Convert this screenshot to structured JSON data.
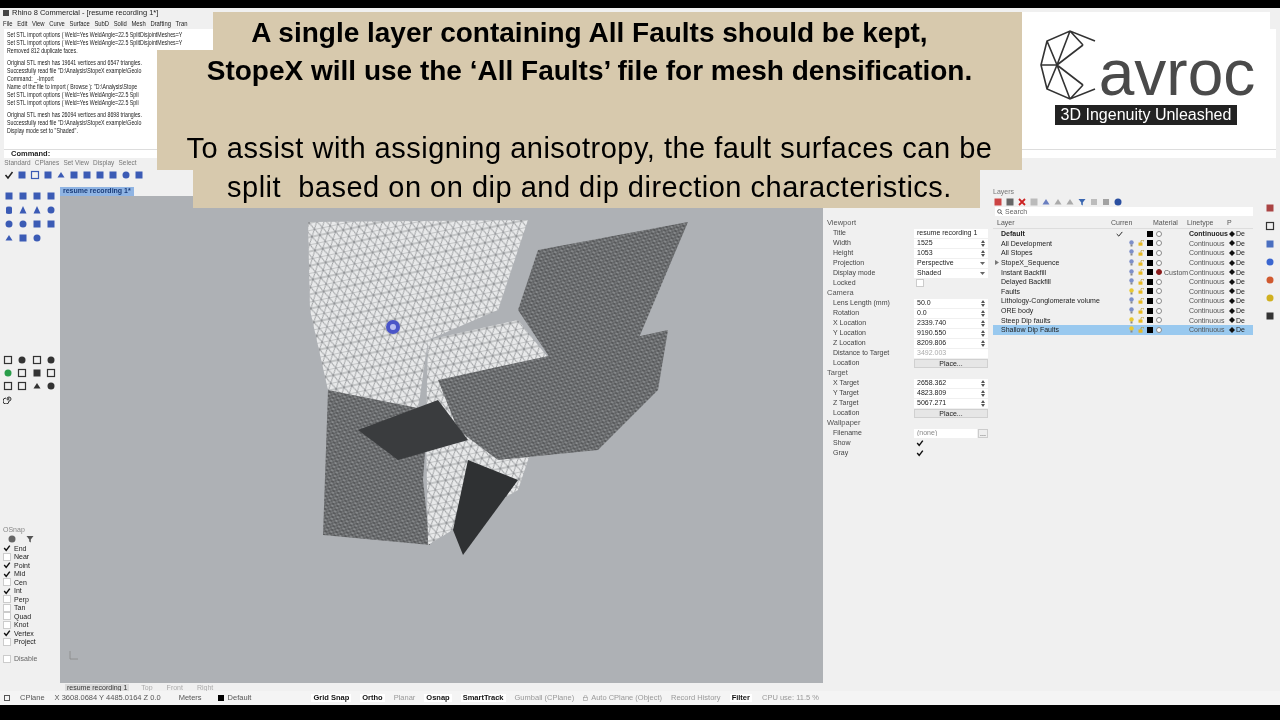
{
  "overlay": {
    "heading": [
      "A single layer containing All Faults should be kept,",
      "StopeX will use the ‘All Faults’ file for mesh densification."
    ],
    "body": [
      "To assist with assigning anisotropy, the fault surfaces can be",
      "split  based on on dip and dip direction characteristics."
    ]
  },
  "logo": {
    "wordmark": "avroc",
    "tagline": "3D Ingenuity Unleashed"
  },
  "window": {
    "title": "Rhino 8 Commercial - [resume recording 1*]"
  },
  "menu": [
    "File",
    "Edit",
    "View",
    "Curve",
    "Surface",
    "SubD",
    "Solid",
    "Mesh",
    "Drafting",
    "Tran"
  ],
  "command_history": [
    [
      "Set STL import options ( Weld=Yes WeldAngle=22.5 SplitDisjointMeshes=Y",
      "Set STL import options ( Weld=Yes WeldAngle=22.5 SplitDisjointMeshes=Y",
      "Removed 812 duplicate faces."
    ],
    [
      "Original STL mesh has 19641 vertices and 6547 triangles.",
      "Successfully read file \"D:\\Analysis\\StopeX example\\Geolo",
      "Command: _-Import",
      "Name of the file to import ( Browse ): \"D:\\Analysis\\Stope",
      "Set STL import options ( Weld=Yes WeldAngle=22.5 Spli",
      "Set STL import options ( Weld=Yes WeldAngle=22.5 Spli"
    ],
    [
      "Original STL mesh has 26094 vertices and 8698 triangles.",
      "Successfully read file \"D:\\Analysis\\StopeX example\\Geolo",
      "Display mode set to \"Shaded\"."
    ]
  ],
  "command_prompt": "Command:",
  "toolbar_tabs": [
    "Standard",
    "CPlanes",
    "Set View",
    "Display",
    "Select"
  ],
  "viewport": {
    "tab": "resume recording 1*",
    "bottom_tabs": [
      {
        "label": "resume recording 1",
        "selected": true
      },
      {
        "label": "Top",
        "selected": false
      },
      {
        "label": "Front",
        "selected": false
      },
      {
        "label": "Right",
        "selected": false
      }
    ]
  },
  "osnap": {
    "title": "OSnap",
    "items": [
      {
        "label": "End",
        "checked": true
      },
      {
        "label": "Near",
        "checked": false
      },
      {
        "label": "Point",
        "checked": true
      },
      {
        "label": "Mid",
        "checked": true
      },
      {
        "label": "Cen",
        "checked": false
      },
      {
        "label": "Int",
        "checked": true
      },
      {
        "label": "Perp",
        "checked": false
      },
      {
        "label": "Tan",
        "checked": false
      },
      {
        "label": "Quad",
        "checked": false
      },
      {
        "label": "Knot",
        "checked": false
      },
      {
        "label": "Vertex",
        "checked": true
      },
      {
        "label": "Project",
        "checked": false
      }
    ],
    "disable": {
      "label": "Disable",
      "checked": false
    }
  },
  "properties": {
    "sections": [
      {
        "title": "Viewport",
        "rows": [
          {
            "kind": "text",
            "label": "Title",
            "value": "resume recording 1"
          },
          {
            "kind": "spin",
            "label": "Width",
            "value": "1525"
          },
          {
            "kind": "spin",
            "label": "Height",
            "value": "1053"
          },
          {
            "kind": "select",
            "label": "Projection",
            "value": "Perspective"
          },
          {
            "kind": "select",
            "label": "Display mode",
            "value": "Shaded"
          },
          {
            "kind": "check",
            "label": "Locked",
            "checked": false
          }
        ]
      },
      {
        "title": "Camera",
        "rows": [
          {
            "kind": "spin",
            "label": "Lens Length (mm)",
            "value": "50.0"
          },
          {
            "kind": "spin",
            "label": "Rotation",
            "value": "0.0"
          },
          {
            "kind": "spin",
            "label": "X Location",
            "value": "2339.740"
          },
          {
            "kind": "spin",
            "label": "Y Location",
            "value": "9190.550"
          },
          {
            "kind": "spin",
            "label": "Z Location",
            "value": "8209.806"
          },
          {
            "kind": "readonly",
            "label": "Distance to Target",
            "value": "3492.003",
            "disabled": true
          },
          {
            "kind": "button",
            "label": "Location",
            "value": "Place..."
          }
        ]
      },
      {
        "title": "Target",
        "rows": [
          {
            "kind": "spin",
            "label": "X Target",
            "value": "2658.362"
          },
          {
            "kind": "spin",
            "label": "Y Target",
            "value": "4823.809"
          },
          {
            "kind": "spin",
            "label": "Z Target",
            "value": "5067.271"
          },
          {
            "kind": "button",
            "label": "Location",
            "value": "Place..."
          }
        ]
      },
      {
        "title": "Wallpaper",
        "rows": [
          {
            "kind": "file",
            "label": "Filename",
            "placeholder": "(none)",
            "button": "..."
          },
          {
            "kind": "check",
            "label": "Show",
            "checked": true
          },
          {
            "kind": "check",
            "label": "Gray",
            "checked": true
          }
        ]
      }
    ]
  },
  "layers": {
    "title": "Layers",
    "search_placeholder": "Search",
    "columns": [
      "Layer",
      "Curren",
      "Material",
      "Linetype",
      "P"
    ],
    "rows": [
      {
        "name": "Default",
        "current": true,
        "expandable": false,
        "linetype": "Continuous",
        "print": "De",
        "selected": false
      },
      {
        "name": "All Development",
        "current": false,
        "expandable": false,
        "visible": false,
        "linetype": "Continuous",
        "print": "De",
        "selected": false
      },
      {
        "name": "All Stopes",
        "current": false,
        "expandable": false,
        "visible": false,
        "linetype": "Continuous",
        "print": "De",
        "selected": false
      },
      {
        "name": "StopeX_Sequence",
        "current": false,
        "expandable": true,
        "visible": false,
        "linetype": "Continuous",
        "print": "De",
        "selected": false
      },
      {
        "name": "Instant Backfill",
        "current": false,
        "expandable": false,
        "visible": false,
        "material": "Custom",
        "color": "#8b1a1a",
        "linetype": "Continuous",
        "print": "De",
        "selected": false
      },
      {
        "name": "Delayed Backfill",
        "current": false,
        "expandable": false,
        "visible": false,
        "linetype": "Continuous",
        "print": "De",
        "selected": false
      },
      {
        "name": "Faults",
        "current": false,
        "expandable": false,
        "visible": true,
        "linetype": "Continuous",
        "print": "De",
        "selected": false
      },
      {
        "name": "Lithology-Conglomerate volume",
        "current": false,
        "expandable": false,
        "visible": false,
        "linetype": "Continuous",
        "print": "De",
        "selected": false
      },
      {
        "name": "ORE body",
        "current": false,
        "expandable": false,
        "visible": false,
        "linetype": "Continuous",
        "print": "De",
        "selected": false
      },
      {
        "name": "Steep Dip faults",
        "current": false,
        "expandable": false,
        "visible": true,
        "linetype": "Continuous",
        "print": "De",
        "selected": false
      },
      {
        "name": "Shallow Dip Faults",
        "current": false,
        "expandable": false,
        "visible": true,
        "linetype": "Continuous",
        "print": "De",
        "selected": true
      }
    ]
  },
  "status_bar": {
    "cplane": "CPlane",
    "coords": "X 3608.0684 Y 4485.0164 Z 0.0",
    "units": "Meters",
    "layer": "Default",
    "toggles": [
      {
        "label": "Grid Snap",
        "on": true
      },
      {
        "label": "Ortho",
        "on": true
      },
      {
        "label": "Planar",
        "on": false
      },
      {
        "label": "Osnap",
        "on": true
      },
      {
        "label": "SmartTrack",
        "on": true
      },
      {
        "label": "Gumball (CPlane)",
        "on": false
      },
      {
        "label": "Auto CPlane (Object)",
        "on": false,
        "locked": true
      },
      {
        "label": "Record History",
        "on": false
      },
      {
        "label": "Filter",
        "on": true
      }
    ],
    "cpu": "CPU use: 11.5 %"
  }
}
